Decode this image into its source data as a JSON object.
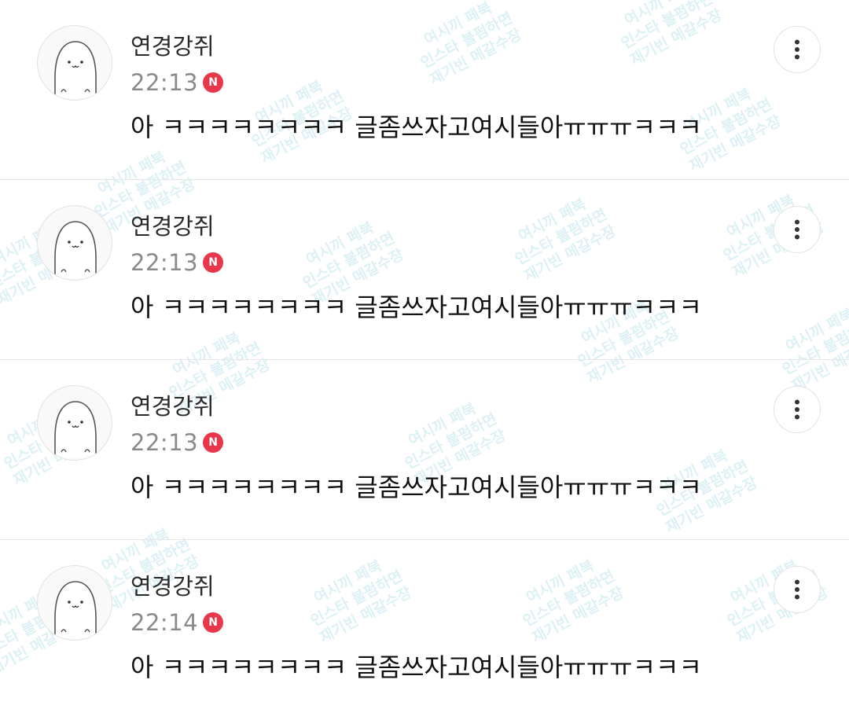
{
  "watermark": {
    "lines": [
      "여시끼 페북",
      "인스타 불펌하면",
      "재기빈 메갈수장"
    ]
  },
  "comments": [
    {
      "author": "연경강쥐",
      "time": "22:13",
      "badge": "N",
      "text": "아 ㅋㅋㅋㅋㅋㅋㅋㅋ 글좀쓰자고여시들아ㅠㅠㅠㅋㅋㅋ",
      "avatar_icon": "seal-character-icon",
      "more_icon": "more-vertical-icon"
    },
    {
      "author": "연경강쥐",
      "time": "22:13",
      "badge": "N",
      "text": "아 ㅋㅋㅋㅋㅋㅋㅋㅋ 글좀쓰자고여시들아ㅠㅠㅠㅋㅋㅋ",
      "avatar_icon": "seal-character-icon",
      "more_icon": "more-vertical-icon"
    },
    {
      "author": "연경강쥐",
      "time": "22:13",
      "badge": "N",
      "text": "아 ㅋㅋㅋㅋㅋㅋㅋㅋ 글좀쓰자고여시들아ㅠㅠㅠㅋㅋㅋ",
      "avatar_icon": "seal-character-icon",
      "more_icon": "more-vertical-icon"
    },
    {
      "author": "연경강쥐",
      "time": "22:14",
      "badge": "N",
      "text": "아 ㅋㅋㅋㅋㅋㅋㅋㅋ 글좀쓰자고여시들아ㅠㅠㅠㅋㅋㅋ",
      "avatar_icon": "seal-character-icon",
      "more_icon": "more-vertical-icon"
    }
  ],
  "colors": {
    "badge": "#e8364a",
    "time": "#8a8a8a",
    "divider": "#e6e6e6",
    "watermark": "#96d2e1"
  }
}
